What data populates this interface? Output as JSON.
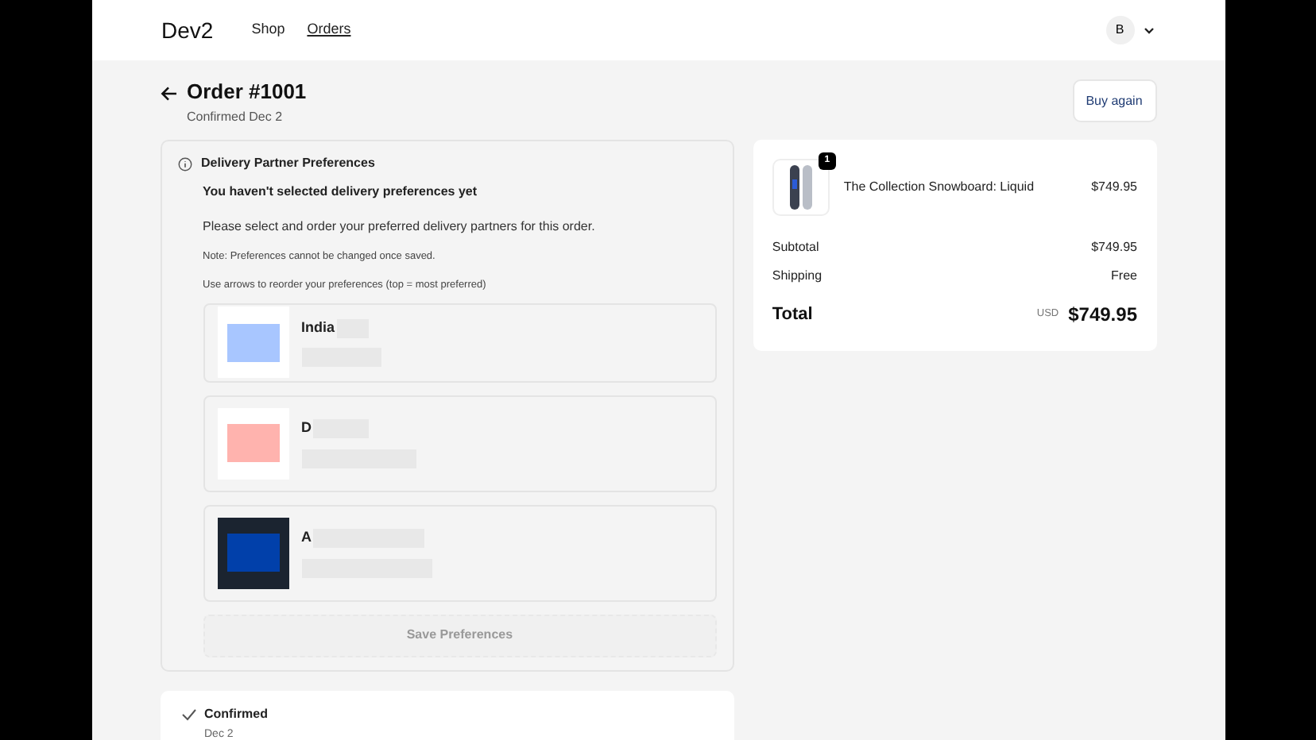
{
  "header": {
    "logo": "Dev2",
    "nav": [
      {
        "label": "Shop",
        "selected": false
      },
      {
        "label": "Orders",
        "selected": true
      }
    ],
    "avatar": "B"
  },
  "order": {
    "title": "Order #1001",
    "subtitle": "Confirmed Dec 2",
    "buy_again": "Buy again"
  },
  "preferences": {
    "title": "Delivery Partner Preferences",
    "heading": "You haven't selected delivery preferences yet",
    "body": "Please select and order your preferred delivery partners for this order.",
    "note": "Note: Preferences cannot be changed once saved.",
    "hint": "Use arrows to reorder your preferences (top = most preferred)",
    "partners": [
      {
        "name": "India",
        "color": "#a8c6ff",
        "kind": "light"
      },
      {
        "name": "D",
        "color": "#ffb3ae",
        "kind": "light"
      },
      {
        "name": "A",
        "color": "#0140aa",
        "kind": "dark"
      }
    ],
    "save": {
      "label": "Save Preferences",
      "disabled": true
    }
  },
  "status": {
    "title": "Confirmed",
    "date": "Dec 2"
  },
  "summary": {
    "item": {
      "name": "The Collection Snowboard: Liquid",
      "price": "$749.95",
      "quantity": "1"
    },
    "subtotal_label": "Subtotal",
    "subtotal": "$749.95",
    "shipping_label": "Shipping",
    "shipping": "Free",
    "total_label": "Total",
    "currency": "USD",
    "total": "$749.95"
  }
}
